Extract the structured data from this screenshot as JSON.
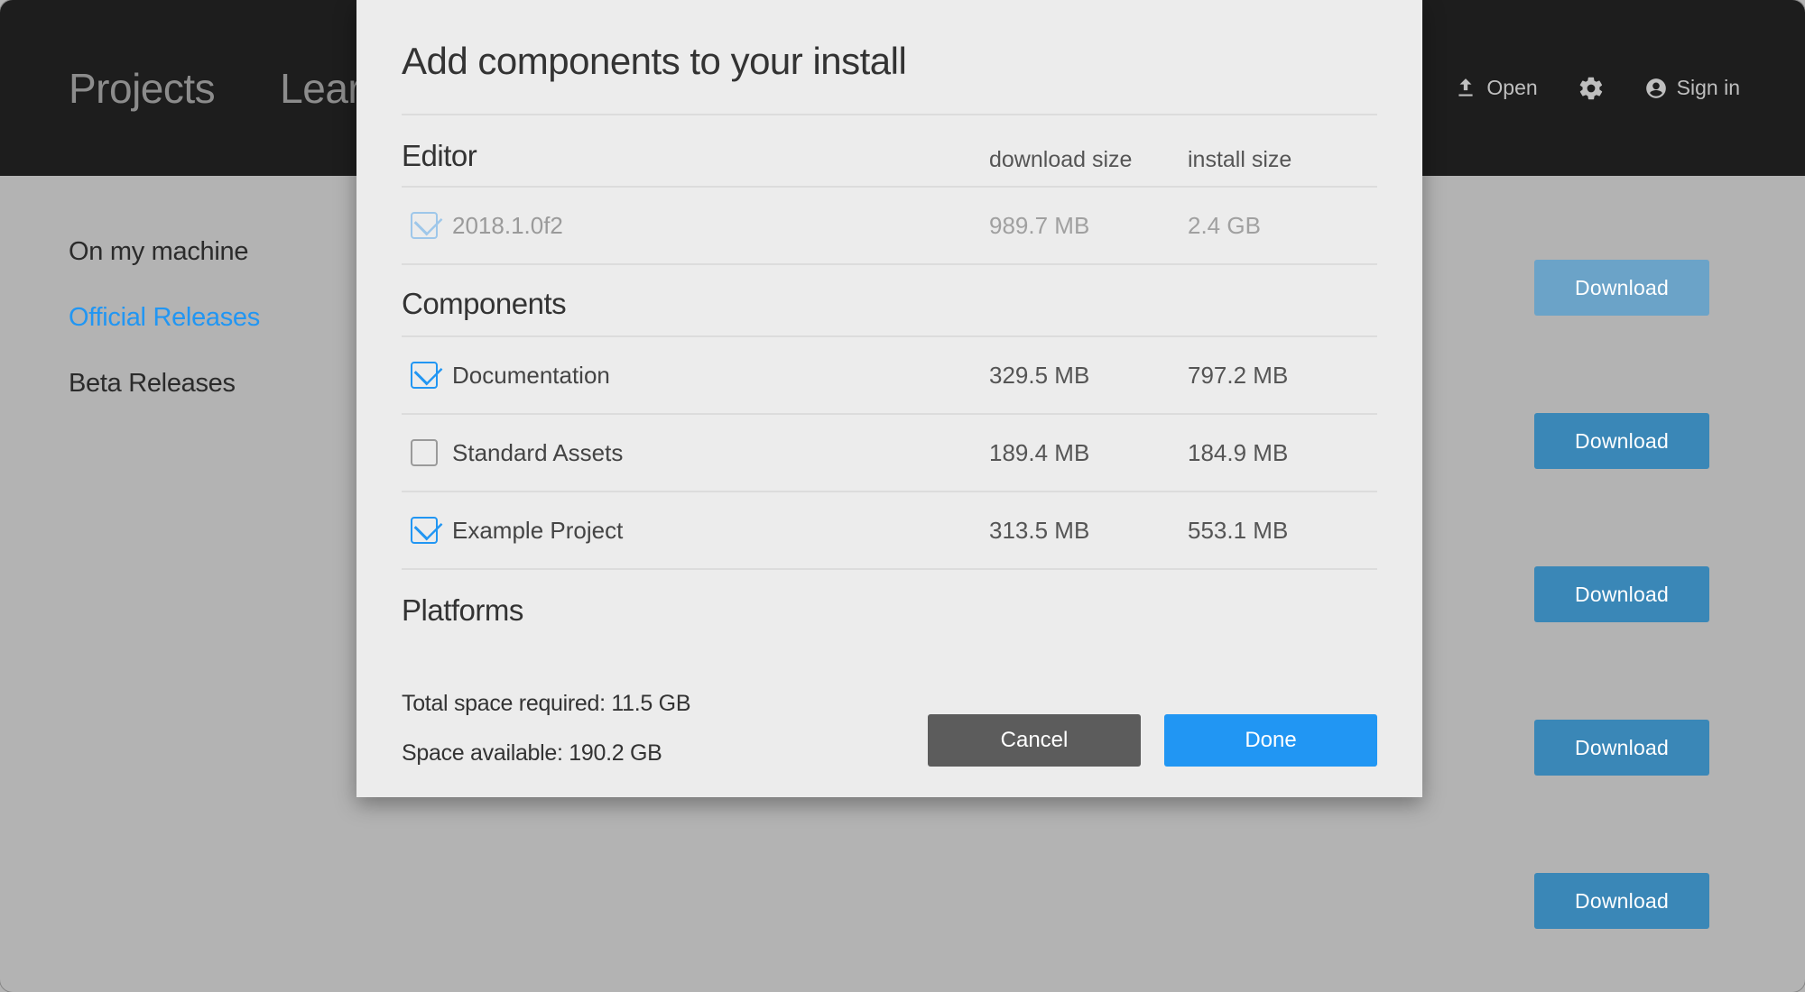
{
  "topbar": {
    "tabs": [
      "Projects",
      "Learn"
    ],
    "open_label": "Open",
    "signin_label": "Sign in"
  },
  "sidebar": {
    "items": [
      {
        "label": "On my machine",
        "active": false
      },
      {
        "label": "Official Releases",
        "active": true
      },
      {
        "label": "Beta Releases",
        "active": false
      }
    ]
  },
  "download_button_label": "Download",
  "background_download_count": 5,
  "modal": {
    "title": "Add components to your install",
    "editor_section_label": "Editor",
    "col_download": "download size",
    "col_install": "install size",
    "editor_row": {
      "name": "2018.1.0f2",
      "download_size": "989.7 MB",
      "install_size": "2.4 GB",
      "checked": true,
      "disabled": true
    },
    "components_section_label": "Components",
    "components": [
      {
        "name": "Documentation",
        "download_size": "329.5 MB",
        "install_size": "797.2 MB",
        "checked": true
      },
      {
        "name": "Standard Assets",
        "download_size": "189.4 MB",
        "install_size": "184.9 MB",
        "checked": false
      },
      {
        "name": "Example Project",
        "download_size": "313.5 MB",
        "install_size": "553.1 MB",
        "checked": true
      }
    ],
    "platforms_section_label": "Platforms",
    "total_space_label": "Total space required: 11.5 GB",
    "space_available_label": "Space available: 190.2 GB",
    "cancel_label": "Cancel",
    "done_label": "Done"
  }
}
